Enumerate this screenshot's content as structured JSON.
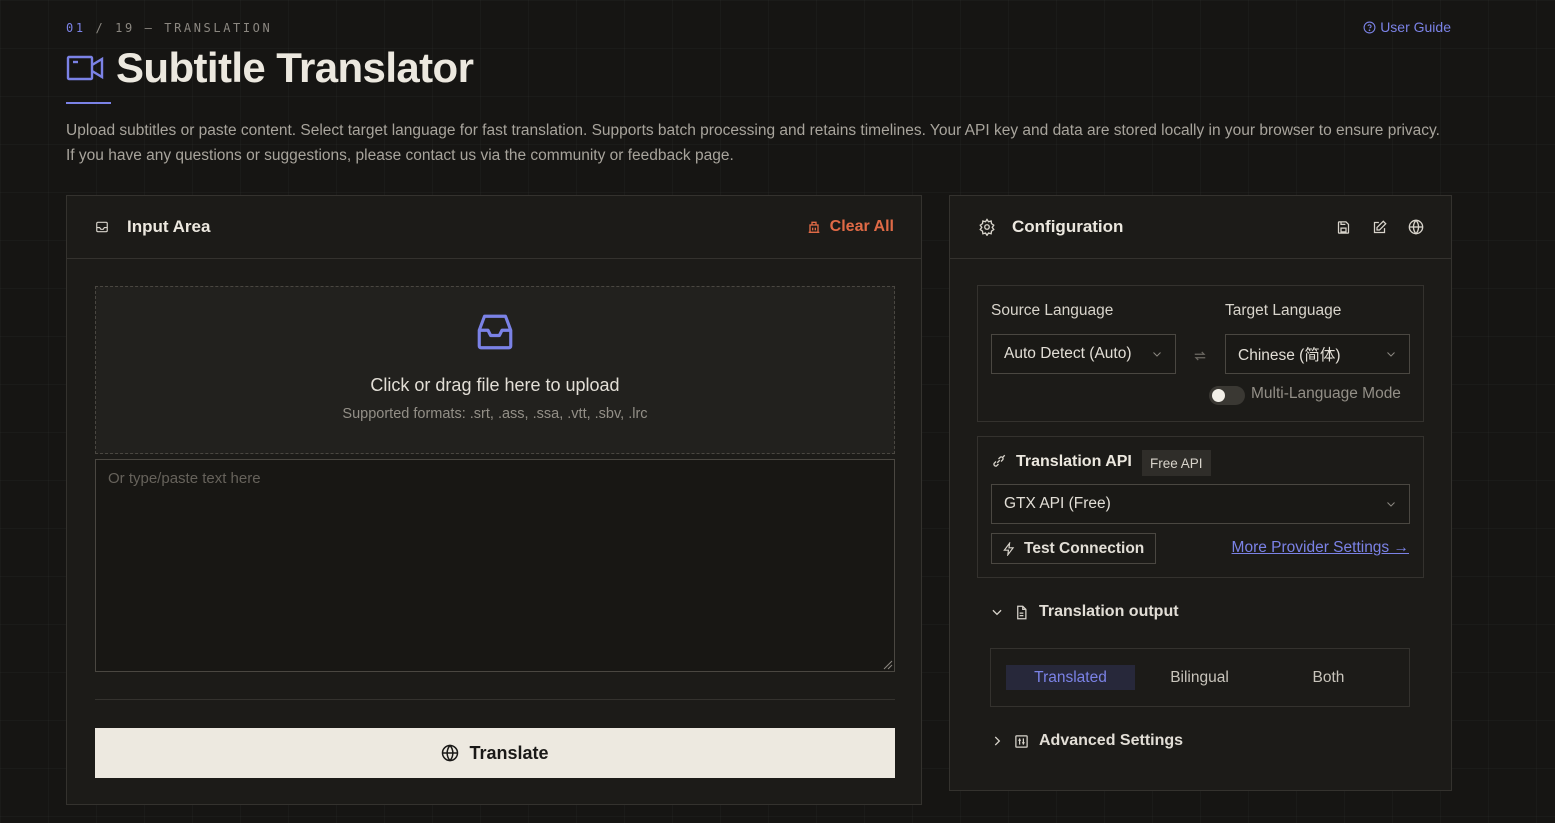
{
  "header": {
    "kicker_num": "01",
    "kicker_rest": " / 19 — TRANSLATION",
    "user_guide": "User Guide",
    "title": "Subtitle Translator",
    "description": "Upload subtitles or paste content. Select target language for fast translation. Supports batch processing and retains timelines. Your API key and data are stored locally in your browser to ensure privacy. If you have any questions or suggestions, please contact us via the community or feedback page."
  },
  "input_panel": {
    "title": "Input Area",
    "clear_all": "Clear All",
    "dropzone_main": "Click or drag file here to upload",
    "dropzone_sub": "Supported formats: .srt, .ass, .ssa, .vtt, .sbv, .lrc",
    "textarea_placeholder": "Or type/paste text here",
    "textarea_value": "",
    "translate_button": "Translate"
  },
  "config_panel": {
    "title": "Configuration",
    "source_language_label": "Source Language",
    "source_language_value": "Auto Detect (Auto)",
    "target_language_label": "Target Language",
    "target_language_value": "Chinese (简体)",
    "multi_language_mode": "Multi-Language Mode",
    "multi_language_enabled": false,
    "api_title": "Translation API",
    "api_badge": "Free API",
    "api_value": "GTX API (Free)",
    "test_connection": "Test Connection",
    "more_provider_settings": "More Provider Settings →",
    "output_section": "Translation output",
    "output_options": [
      "Translated",
      "Bilingual",
      "Both"
    ],
    "output_selected": "Translated",
    "advanced_settings": "Advanced Settings"
  },
  "colors": {
    "accent": "#7b82e6",
    "danger": "#e06a46",
    "background": "#161513",
    "panel": "#1c1b18",
    "button_light": "#ede9e0"
  },
  "icons": [
    "video-icon",
    "help-circle-icon",
    "inbox-icon",
    "trash-icon",
    "upload-inbox-icon",
    "globe-icon",
    "gear-icon",
    "save-icon",
    "edit-icon",
    "link-icon",
    "zap-icon",
    "chevron-down-icon",
    "chevron-right-icon",
    "file-icon",
    "sliders-icon",
    "swap-icon"
  ]
}
